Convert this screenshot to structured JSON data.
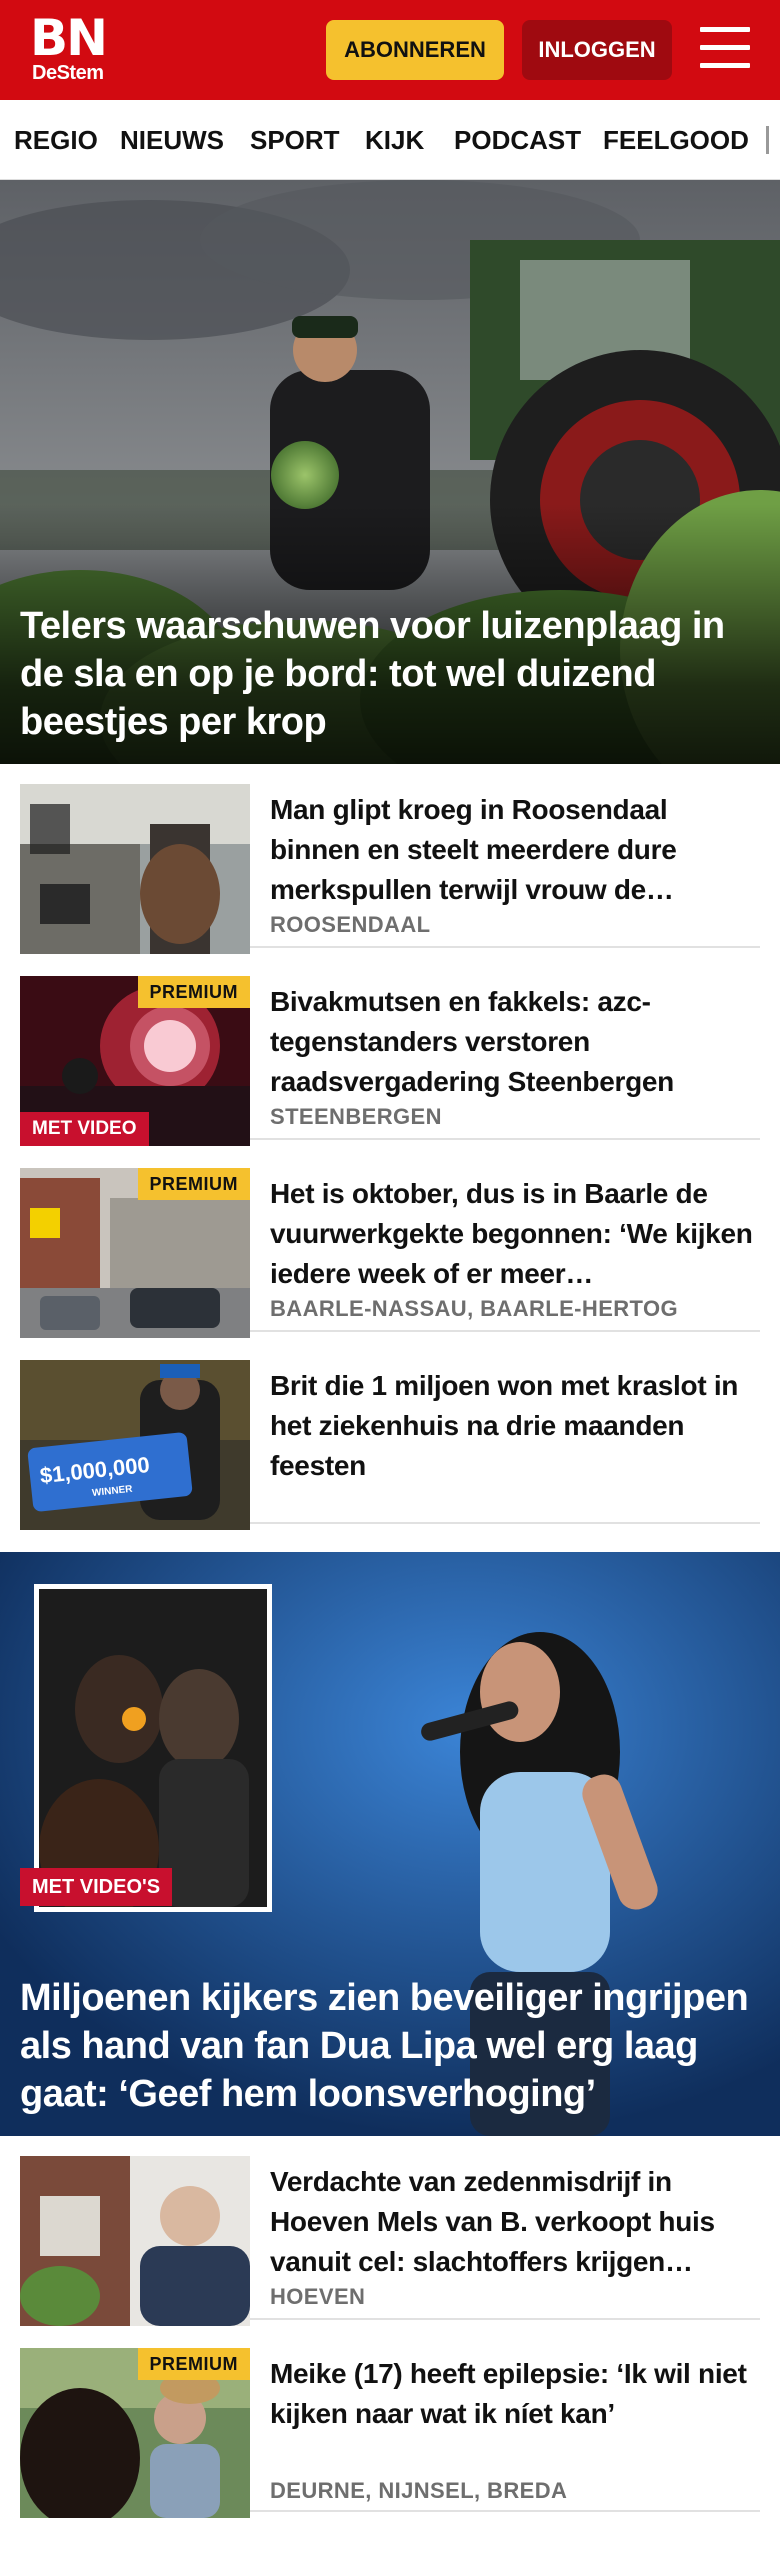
{
  "header": {
    "logo_main": "BN",
    "logo_sub": "DeStem",
    "subscribe_label": "ABONNEREN",
    "login_label": "INLOGGEN",
    "brand_color": "#d20a11"
  },
  "nav": {
    "items": [
      {
        "label": "REGIO"
      },
      {
        "label": "NIEUWS"
      },
      {
        "label": "SPORT"
      },
      {
        "label": "KIJK"
      },
      {
        "label": "PODCAST"
      },
      {
        "label": "FEELGOOD"
      }
    ]
  },
  "hero": {
    "title": "Telers waarschuwen voor luizenplaag in de sla en op je bord: tot wel duizend beestjes per krop"
  },
  "articles": [
    {
      "title": "Man glipt kroeg in Roosendaal binnen en steelt meerdere dure merkspullen terwijl vrouw de…",
      "location": "ROOSENDAAL",
      "badge": ""
    },
    {
      "title": "Bivakmutsen en fakkels: azc-tegenstanders verstoren raadsvergadering Steenbergen",
      "location": "STEENBERGEN",
      "badge": "PREMIUM",
      "video_badge": "MET VIDEO"
    },
    {
      "title": "Het is oktober, dus is in Baarle de vuurwerkgekte begonnen: ‘We kijken iedere week of er meer…",
      "location": "BAARLE-NASSAU, BAARLE-HERTOG",
      "badge": "PREMIUM"
    },
    {
      "title": "Brit die 1 miljoen won met kraslot in het ziekenhuis na drie maanden feesten",
      "location": "",
      "badge": "",
      "image_text": "$1,000,000",
      "image_subtext": "WINNER"
    },
    {
      "title": "Verdachte van zedenmisdrijf in Hoeven Mels van B. verkoopt huis vanuit cel: slachtoffers krijgen…",
      "location": "HOEVEN",
      "badge": ""
    },
    {
      "title": "Meike (17) heeft epilepsie: ‘Ik wil niet kijken naar wat ik níet kan’",
      "location": "DEURNE, NIJNSEL, BREDA",
      "badge": "PREMIUM"
    }
  ],
  "feature": {
    "badge": "MET VIDEO'S",
    "title": "Miljoenen kijkers zien beveiliger ingrijpen als hand van fan Dua Lipa wel erg laag gaat: ‘Geef hem loonsverhoging’"
  },
  "colors": {
    "premium": "#f5c12e",
    "video": "#c8102e",
    "location_text": "#6e6e6e"
  }
}
